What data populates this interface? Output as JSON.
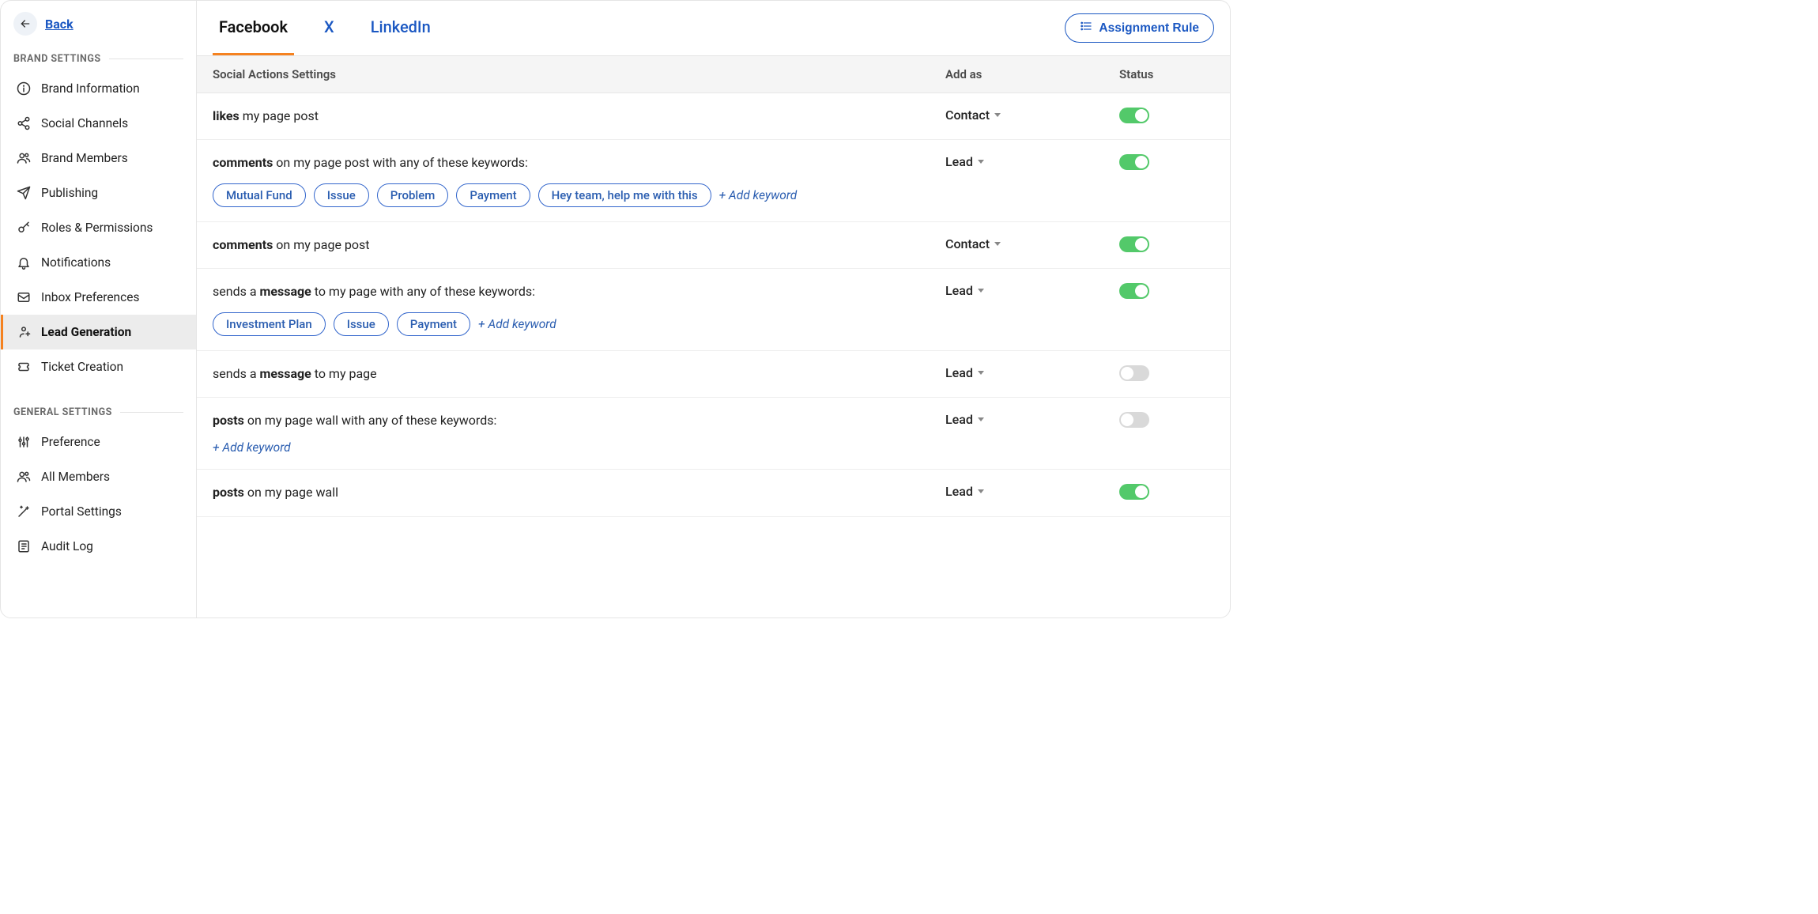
{
  "back": {
    "label": "Back"
  },
  "sidebar": {
    "sections": [
      {
        "title": "BRAND SETTINGS",
        "items": [
          {
            "label": "Brand Information",
            "icon": "info"
          },
          {
            "label": "Social Channels",
            "icon": "share"
          },
          {
            "label": "Brand Members",
            "icon": "members"
          },
          {
            "label": "Publishing",
            "icon": "send"
          },
          {
            "label": "Roles & Permissions",
            "icon": "key"
          },
          {
            "label": "Notifications",
            "icon": "bell"
          },
          {
            "label": "Inbox Preferences",
            "icon": "inbox"
          },
          {
            "label": "Lead Generation",
            "icon": "leadgen",
            "active": true
          },
          {
            "label": "Ticket Creation",
            "icon": "ticket"
          }
        ]
      },
      {
        "title": "GENERAL SETTINGS",
        "items": [
          {
            "label": "Preference",
            "icon": "sliders"
          },
          {
            "label": "All Members",
            "icon": "members"
          },
          {
            "label": "Portal Settings",
            "icon": "wand"
          },
          {
            "label": "Audit Log",
            "icon": "log"
          }
        ]
      }
    ]
  },
  "tabs": [
    {
      "label": "Facebook",
      "active": true
    },
    {
      "label": "X"
    },
    {
      "label": "LinkedIn"
    }
  ],
  "assignment_rule_label": "Assignment Rule",
  "table_head": {
    "actions": "Social Actions Settings",
    "addas": "Add as",
    "status": "Status"
  },
  "add_keyword_label": "+ Add keyword",
  "rules": [
    {
      "pre": "",
      "strong": "likes",
      "post": " my page post",
      "keywords": null,
      "addas": "Contact",
      "status": true
    },
    {
      "pre": "",
      "strong": "comments",
      "post": " on my page post with any of these keywords:",
      "keywords": [
        "Mutual Fund",
        "Issue",
        "Problem",
        "Payment",
        "Hey team, help me with this"
      ],
      "addas": "Lead",
      "status": true
    },
    {
      "pre": "",
      "strong": "comments",
      "post": " on my page post",
      "keywords": null,
      "addas": "Contact",
      "status": true
    },
    {
      "pre": "sends a ",
      "strong": "message",
      "post": " to my page with any of these keywords:",
      "keywords": [
        "Investment Plan",
        "Issue",
        "Payment"
      ],
      "addas": "Lead",
      "status": true
    },
    {
      "pre": "sends a ",
      "strong": "message",
      "post": " to my page",
      "keywords": null,
      "addas": "Lead",
      "status": false
    },
    {
      "pre": "",
      "strong": "posts",
      "post": " on my page wall with any of these keywords:",
      "keywords": [],
      "addas": "Lead",
      "status": false
    },
    {
      "pre": "",
      "strong": "posts",
      "post": " on my page wall",
      "keywords": null,
      "addas": "Lead",
      "status": true
    }
  ]
}
